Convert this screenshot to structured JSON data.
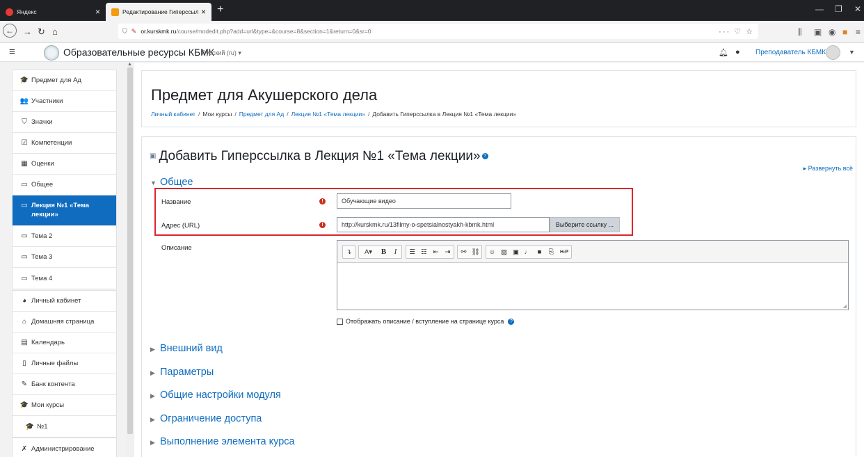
{
  "browser": {
    "tabs": [
      {
        "label": "Яндекс",
        "favicon_color": "#e53935"
      },
      {
        "label": "Редактирование Гиперссылка",
        "favicon_color": "#f39c12"
      }
    ],
    "url_host": "or.kurskmk.ru",
    "url_path": "/course/modedit.php?add=url&type=&course=8&section=1&return=0&sr=0"
  },
  "header": {
    "site_name": "Образовательные ресурсы КБМК",
    "language": "Русский (ru) ▾",
    "user_name": "Преподаватель КБМК"
  },
  "sidebar": {
    "group1": [
      {
        "icon": "🎓",
        "label": "Предмет для Ад"
      },
      {
        "icon": "👥",
        "label": "Участники"
      },
      {
        "icon": "⛉",
        "label": "Значки"
      },
      {
        "icon": "☑",
        "label": "Компетенции"
      },
      {
        "icon": "▦",
        "label": "Оценки"
      },
      {
        "icon": "▭",
        "label": "Общее"
      },
      {
        "icon": "▭",
        "label": "Лекция №1 «Тема лекции»",
        "active": true
      },
      {
        "icon": "▭",
        "label": "Тема 2"
      },
      {
        "icon": "▭",
        "label": "Тема 3"
      },
      {
        "icon": "▭",
        "label": "Тема 4"
      }
    ],
    "group2": [
      {
        "icon": "◕",
        "label": "Личный кабинет"
      },
      {
        "icon": "⌂",
        "label": "Домашняя страница"
      },
      {
        "icon": "▤",
        "label": "Календарь"
      },
      {
        "icon": "▯",
        "label": "Личные файлы"
      },
      {
        "icon": "✎",
        "label": "Банк контента"
      },
      {
        "icon": "🎓",
        "label": "Мои курсы"
      },
      {
        "icon": "🎓",
        "label": "№1"
      }
    ],
    "group3": [
      {
        "icon": "✗",
        "label": "Администрирование"
      }
    ]
  },
  "page": {
    "title": "Предмет для Акушерского дела",
    "breadcrumb": [
      {
        "label": "Личный кабинет",
        "link": true
      },
      {
        "label": "Мои курсы",
        "link": false
      },
      {
        "label": "Предмет для Ад",
        "link": true
      },
      {
        "label": "Лекция №1 «Тема лекции»",
        "link": true
      },
      {
        "label": "Добавить Гиперссылка в Лекция №1 «Тема лекции»",
        "link": false
      }
    ]
  },
  "form": {
    "heading": "Добавить Гиперссылка в Лекция №1 «Тема лекции»",
    "expand_all": "Развернуть всё",
    "general_section": "Общее",
    "name_label": "Название",
    "name_value": "Обучающие видео",
    "url_label": "Адрес (URL)",
    "url_value": "http://kurskmk.ru/13filmy-o-spetsialnostyakh-kbmk.html",
    "choose_link_button": "Выберите ссылку ...",
    "description_label": "Описание",
    "show_description_checkbox": "Отображать описание / вступление на странице курса",
    "sections": [
      "Внешний вид",
      "Параметры",
      "Общие настройки модуля",
      "Ограничение доступа",
      "Выполнение элемента курса"
    ]
  },
  "colors": {
    "accent": "#0f6cbf",
    "highlight_box": "#d9262e",
    "required_icon": "#ca3120"
  }
}
